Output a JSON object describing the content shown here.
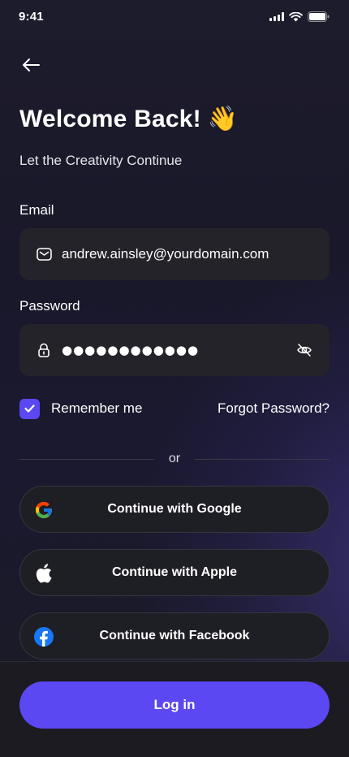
{
  "status_bar": {
    "time": "9:41",
    "icons": [
      "signal-icon",
      "wifi-icon",
      "battery-icon"
    ]
  },
  "header": {
    "back_icon": "arrow-left-icon",
    "title": "Welcome Back!",
    "emoji": "👋",
    "subtitle": "Let the Creativity Continue"
  },
  "form": {
    "email_label": "Email",
    "email_value": "andrew.ainsley@yourdomain.com",
    "password_label": "Password",
    "password_mask": "●●●●●●●●●●●●",
    "remember_label": "Remember me",
    "remember_checked": true,
    "forgot_label": "Forgot Password?"
  },
  "divider_text": "or",
  "social": [
    {
      "label": "Continue with Google",
      "icon": "google-icon"
    },
    {
      "label": "Continue with Apple",
      "icon": "apple-icon"
    },
    {
      "label": "Continue with Facebook",
      "icon": "facebook-icon"
    }
  ],
  "login_label": "Log in",
  "colors": {
    "accent": "#5B48F2",
    "field_bg": "#232329",
    "background": "#19182A"
  }
}
